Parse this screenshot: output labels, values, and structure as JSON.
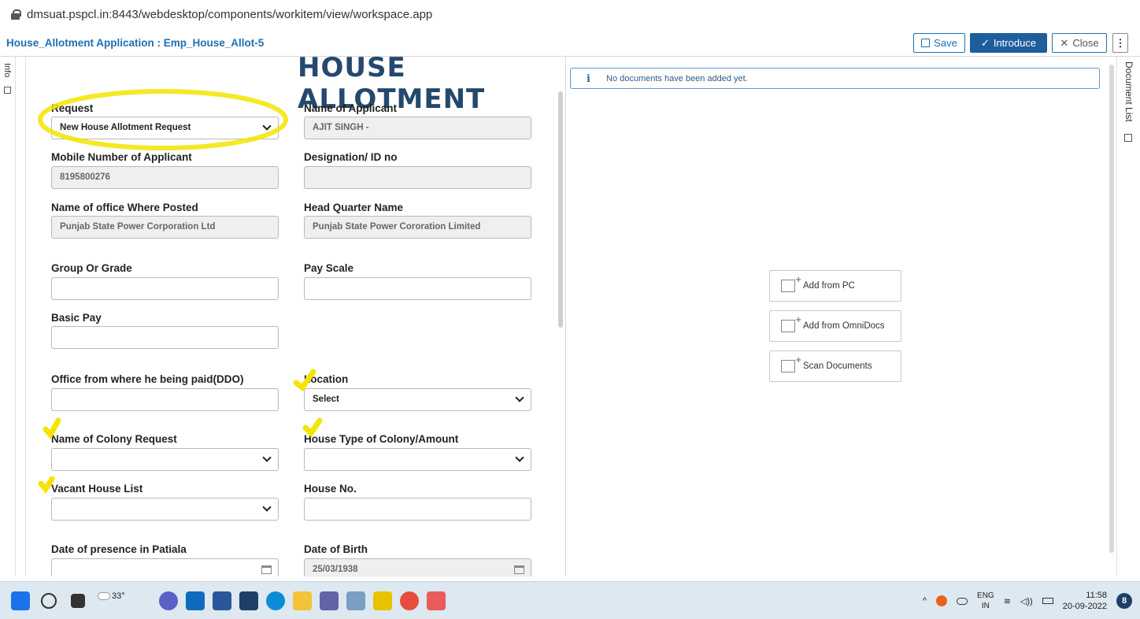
{
  "browser": {
    "url": "dmsuat.pspcl.in:8443/webdesktop/components/workitem/view/workspace.app"
  },
  "header": {
    "title": "House_Allotment Application : Emp_House_Allot-5",
    "save_label": "Save",
    "introduce_label": "Introduce",
    "close_label": "Close",
    "more_label": "⋮"
  },
  "left_rail": {
    "label": "Info"
  },
  "form": {
    "banner": "HOUSE ALLOTMENT",
    "request": {
      "label": "Request",
      "value": "New House Allotment Request"
    },
    "applicant_name": {
      "label": "Name of Applicant",
      "value": "AJIT SINGH -"
    },
    "mobile": {
      "label": "Mobile Number of Applicant",
      "value": "8195800276"
    },
    "designation": {
      "label": "Designation/ ID no",
      "value": ""
    },
    "office_posted": {
      "label": "Name of office Where Posted",
      "value": "Punjab State Power Corporation Ltd"
    },
    "head_quarter": {
      "label": "Head Quarter Name",
      "value": "Punjab State Power Cororation Limited"
    },
    "group_grade": {
      "label": "Group Or Grade",
      "value": ""
    },
    "pay_scale": {
      "label": "Pay Scale",
      "value": ""
    },
    "basic_pay": {
      "label": "Basic Pay",
      "value": ""
    },
    "ddo_office": {
      "label": "Office from where he being paid(DDO)",
      "value": ""
    },
    "location": {
      "label": "Location",
      "value": "Select"
    },
    "colony_request": {
      "label": "Name of Colony Request",
      "value": ""
    },
    "house_type": {
      "label": "House Type of Colony/Amount",
      "value": ""
    },
    "vacant_house": {
      "label": "Vacant House List",
      "value": ""
    },
    "house_no": {
      "label": "House No.",
      "value": ""
    },
    "presence_date": {
      "label": "Date of presence in Patiala",
      "value": ""
    },
    "dob": {
      "label": "Date of Birth",
      "value": "25/03/1938"
    }
  },
  "documents": {
    "notice": "No documents have been added yet.",
    "add_pc": "Add from PC",
    "add_omnidocs": "Add from OmniDocs",
    "scan": "Scan Documents"
  },
  "right_rail": {
    "label": "Document List"
  },
  "taskbar": {
    "weather": "33°",
    "lang_top": "ENG",
    "lang_bottom": "IN",
    "time": "11:58",
    "date": "20-09-2022",
    "badge": "8"
  },
  "colors": {
    "brand": "#1f5e9c",
    "link": "#1f6fb2",
    "highlight": "#f5e400"
  }
}
